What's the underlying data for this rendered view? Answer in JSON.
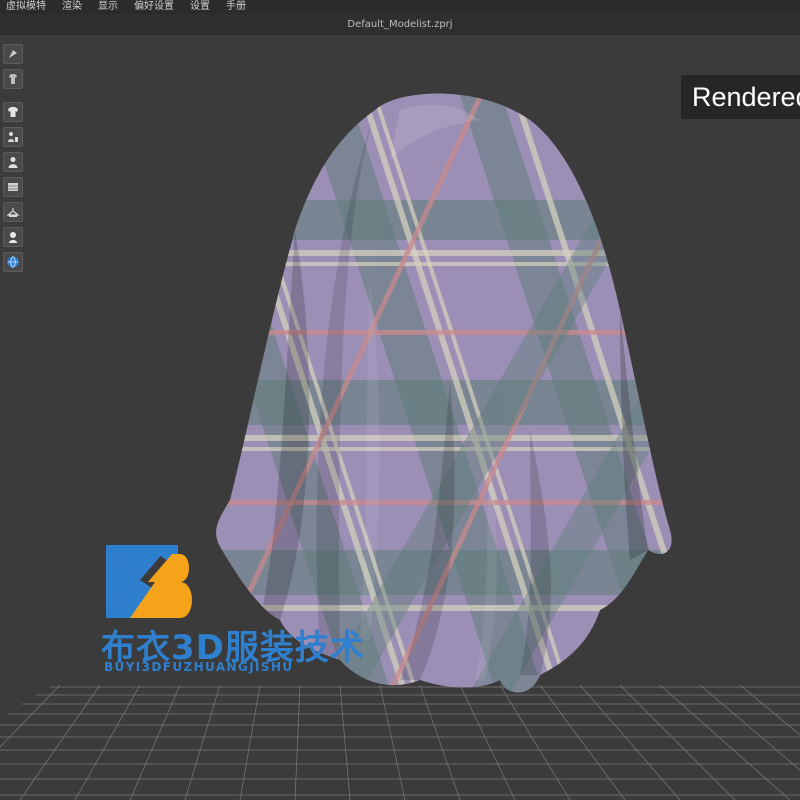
{
  "menu": {
    "items": [
      "虚拟模特",
      "渲染",
      "显示",
      "偏好设置",
      "设置",
      "手册"
    ]
  },
  "window": {
    "title": "Default_Modelist.zprj"
  },
  "toolbar": {
    "icons": [
      "avatar-pose-icon",
      "garment-icon",
      "shirt-icon",
      "avatar-edit-icon",
      "avatar-icon",
      "fabric-icon",
      "hanger-icon",
      "avatar-head-icon",
      "globe-icon"
    ]
  },
  "viewport": {
    "badge_text": "Rendered"
  },
  "watermark": {
    "title": "布衣3D服装技术",
    "subtitle": "BUYI3DFUZHUANGJISHU",
    "colors": {
      "blue": "#2f7fcf",
      "orange": "#f5a31a"
    }
  },
  "colors": {
    "background": "#3a3a3a",
    "menubar": "#2b2b2b",
    "plaid_purple": "#9b8fb5",
    "plaid_green": "#5e7d78",
    "plaid_pink": "#c98a8c",
    "plaid_cream": "#d9d4c0"
  }
}
